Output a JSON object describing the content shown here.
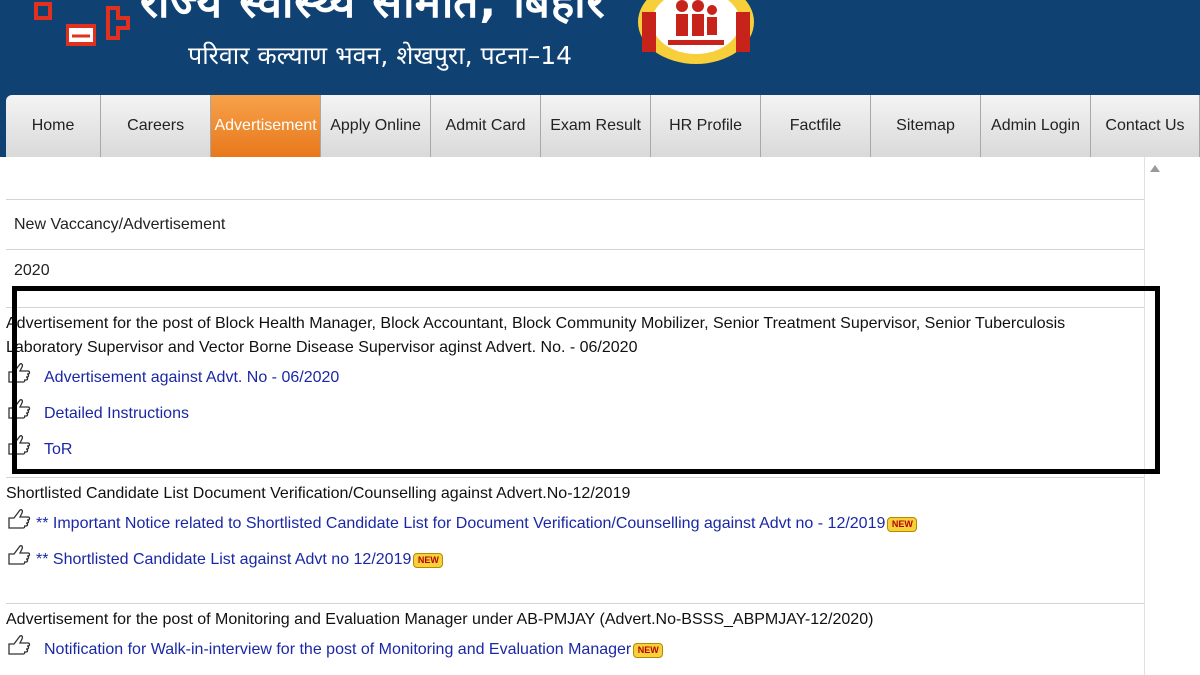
{
  "header": {
    "title": "राज्य स्वास्थ्य समिति, बिहार",
    "subtitle": "परिवार कल्याण भवन, शेखपुरा, पटना–14"
  },
  "nav": {
    "items": [
      {
        "label": "Home",
        "active": false
      },
      {
        "label": "Careers",
        "active": false
      },
      {
        "label": "Advertisement",
        "active": true
      },
      {
        "label": "Apply Online",
        "active": false
      },
      {
        "label": "Admit Card",
        "active": false
      },
      {
        "label": "Exam Result",
        "active": false
      },
      {
        "label": "HR Profile",
        "active": false
      },
      {
        "label": "Factfile",
        "active": false
      },
      {
        "label": "Sitemap",
        "active": false
      },
      {
        "label": "Admin Login",
        "active": false
      },
      {
        "label": "Contact Us",
        "active": false
      }
    ]
  },
  "content": {
    "section_title": "New Vaccancy/Advertisement",
    "year": "2020",
    "blocks": [
      {
        "title": "Advertisement for the post of Block Health Manager, Block Accountant, Block Community Mobilizer, Senior Treatment Supervisor, Senior Tuberculosis Laboratory Supervisor and Vector Borne Disease Supervisor aginst Advert. No. - 06/2020",
        "links": [
          {
            "label": "Advertisement against Advt. No - 06/2020"
          },
          {
            "label": "Detailed Instructions"
          },
          {
            "label": "ToR"
          }
        ]
      },
      {
        "title": "Shortlisted Candidate List Document Verification/Counselling against Advert.No-12/2019",
        "links": [
          {
            "label": "** Important Notice related to Shortlisted Candidate List for Document Verification/Counselling against Advt no - 12/2019",
            "badge": "NEW"
          },
          {
            "label": "** Shortlisted Candidate List against Advt no   12/2019",
            "badge": "NEW"
          }
        ]
      },
      {
        "title": "Advertisement for the post of Monitoring and Evaluation Manager under AB-PMJAY (Advert.No-BSSS_ABPMJAY-12/2020)",
        "links": [
          {
            "label": "Notification for Walk-in-interview for the post of Monitoring and Evaluation Manager",
            "badge": "NEW"
          }
        ]
      }
    ]
  },
  "colors": {
    "banner": "#0f4173",
    "nav_active": "#e8781c",
    "link": "#1a28a6",
    "highlight_border": "#000000"
  },
  "icons": {
    "link_bullet": "pointing-hand-icon",
    "badge": "new-badge-icon"
  }
}
